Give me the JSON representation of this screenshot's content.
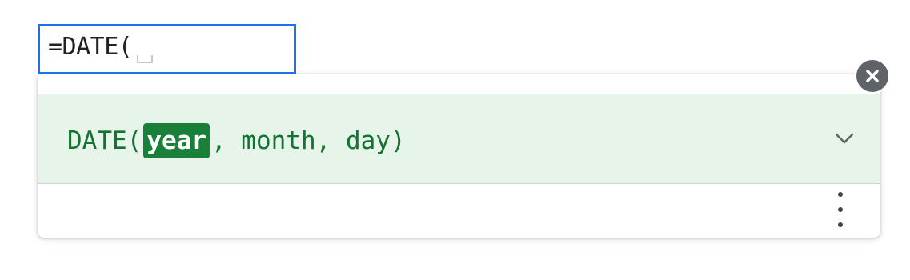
{
  "cell_editor": {
    "formula_text": "=DATE("
  },
  "formula_help": {
    "function_name": "DATE(",
    "active_argument": "year",
    "remaining_arguments": ", month, day)"
  },
  "icons": {
    "close": "close-icon",
    "expand": "chevron-down-icon",
    "more": "more-vert-icon"
  },
  "colors": {
    "cell_border": "#1a73e8",
    "help_background": "#e6f4ea",
    "signature_text": "#137333",
    "active_argument_background": "#188038",
    "close_button": "#5f6368"
  }
}
